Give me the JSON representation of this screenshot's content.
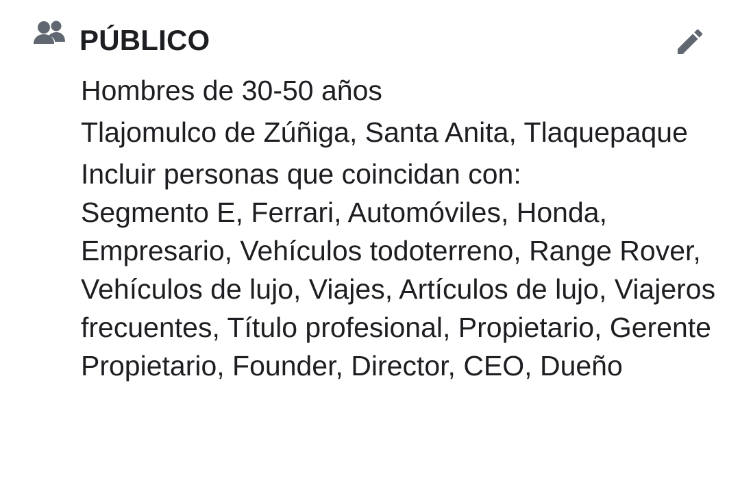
{
  "section": {
    "icon": "people-icon",
    "title": "PÚBLICO",
    "edit_icon": "pencil-icon"
  },
  "audience": {
    "demographic": "Hombres de 30-50 años",
    "locations": "Tlajomulco de Zúñiga, Santa Anita, Tlaquepaque",
    "interests_prefix": "Incluir personas que coincidan con:",
    "interests": "Segmento E, Ferrari, Automóviles, Honda, Empresario, Vehículos todoterreno, Range Rover, Vehículos de lujo, Viajes, Artículos de lujo, Viajeros frecuentes, Título profesional, Propietario, Gerente Propietario, Founder, Director, CEO, Dueño"
  },
  "colors": {
    "text": "#1c1e21",
    "icon": "#606770"
  }
}
